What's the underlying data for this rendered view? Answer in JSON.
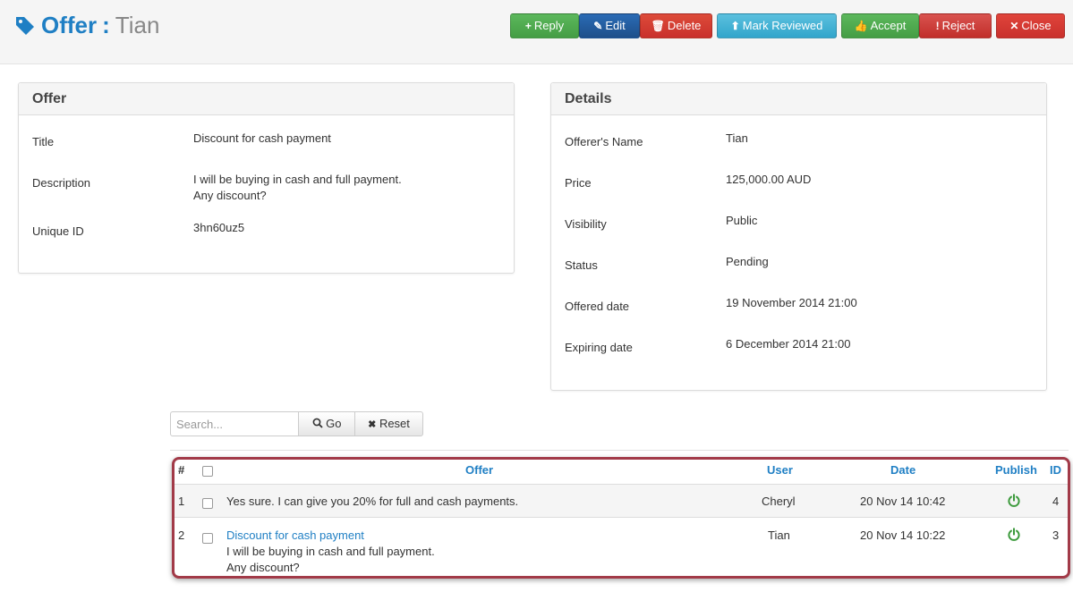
{
  "header": {
    "title": "Offer",
    "separator": ":",
    "subtitle": "Tian",
    "buttons": {
      "reply": "Reply",
      "edit": "Edit",
      "delete": "Delete",
      "mark_reviewed": "Mark Reviewed",
      "accept": "Accept",
      "reject": "Reject",
      "close": "Close"
    }
  },
  "offer_panel": {
    "heading": "Offer",
    "rows": [
      {
        "label": "Title",
        "value": "Discount for cash payment"
      },
      {
        "label": "Description",
        "value_line1": "I will be buying in cash and full payment.",
        "value_line2": "Any discount?"
      },
      {
        "label": "Unique ID",
        "value": "3hn60uz5"
      }
    ]
  },
  "details_panel": {
    "heading": "Details",
    "rows": [
      {
        "label": "Offerer's Name",
        "value": "Tian"
      },
      {
        "label": "Price",
        "value": "125,000.00 AUD"
      },
      {
        "label": "Visibility",
        "value": "Public"
      },
      {
        "label": "Status",
        "value": "Pending"
      },
      {
        "label": "Offered date",
        "value": "19 November 2014 21:00"
      },
      {
        "label": "Expiring date",
        "value": "6 December 2014 21:00"
      }
    ]
  },
  "search": {
    "placeholder": "Search...",
    "go_label": "Go",
    "reset_label": "Reset"
  },
  "table": {
    "columns": {
      "num": "#",
      "offer": "Offer",
      "user": "User",
      "date": "Date",
      "publish": "Publish",
      "id": "ID"
    },
    "rows": [
      {
        "num": "1",
        "offer": "Yes sure. I can give you 20% for full and cash payments.",
        "user": "Cheryl",
        "date": "20 Nov 14 10:42",
        "id": "4"
      },
      {
        "num": "2",
        "offer_title": "Discount for cash payment",
        "offer_line1": "I will be buying in cash and full payment.",
        "offer_line2": "Any discount?",
        "user": "Tian",
        "date": "20 Nov 14 10:22",
        "id": "3"
      }
    ]
  },
  "colors": {
    "accent": "#1f7fc4",
    "publish_icon": "#3c9a3c",
    "highlight_border": "#a23a48"
  }
}
